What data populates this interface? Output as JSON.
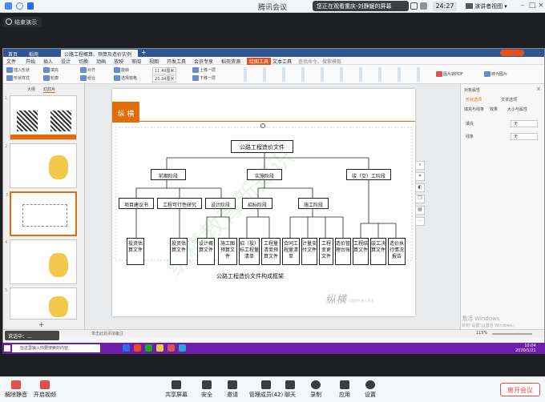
{
  "meeting": {
    "title": "腾讯会议",
    "share_banner": "您正在观看重庆-刘静媛的屏幕",
    "timer": "24:27",
    "view_mode": "演讲者视图",
    "stop_share": "结束演示",
    "mic_overlay": "说话中：..."
  },
  "wps": {
    "tabs": [
      "首页",
      "稻壳",
      "公路工程概算、预算及造价实例"
    ],
    "menu": [
      "文件",
      "开始",
      "插入",
      "设计",
      "切换",
      "动画",
      "放映",
      "审阅",
      "视图",
      "开发工具",
      "会员专享",
      "稻壳资源",
      "绘图工具",
      "文本工具",
      "查找命令、搜索模板"
    ],
    "menu_highlight": "绘图工具",
    "ribbon": [
      "插入形状",
      "形状样式",
      "填充",
      "轮廓",
      "对齐",
      "组合",
      "旋转",
      "选择窗格",
      "上移一层",
      "下移一层",
      "图片转PDF",
      "转为图片"
    ],
    "ribbon_values": [
      "11.49厘米",
      "23.34厘米"
    ],
    "thumb_tabs": [
      "大纲",
      "幻灯片"
    ],
    "slide_numbers": [
      "1",
      "2",
      "3",
      "4",
      "5"
    ],
    "selected_slide_index": 2,
    "status_left": "单击此处添加备注",
    "zoom": "115%",
    "prop_panel": {
      "title": "对象属性",
      "tabs": [
        "形状选项",
        "文本选项"
      ],
      "sub_tabs": [
        "填充与线条",
        "效果",
        "大小与属性"
      ],
      "rows": [
        {
          "label": "填充",
          "value": "无"
        },
        {
          "label": "线条",
          "value": "无"
        }
      ]
    },
    "activation": {
      "title": "激活 Windows",
      "subtitle": "转到\"设置\"以激活 Windows。"
    }
  },
  "slide": {
    "brand": "纵 横",
    "watermark": "纵横教育新知识",
    "logo": "纵横",
    "logo_sub": "建筑·工程造价·施工技术",
    "diagram": {
      "root": "公路工程造价文件",
      "phases": [
        "前期阶段",
        "实施阶段",
        "竣（交）工阶段"
      ],
      "front_items": [
        "项目建议书",
        "工程可行性研究",
        "设计阶段"
      ],
      "front_docs": [
        "投资估算文件",
        "投资估算文件",
        "设计概算文件",
        "施工图预算文件"
      ],
      "impl_items": [
        "招标阶段",
        "施工阶段"
      ],
      "bid_docs": [
        "招（投）标工程量清单",
        "工程量清单预算文件"
      ],
      "construct_docs": [
        "合同工程量清单",
        "计量支付文件",
        "工程变更文件",
        "造价管理台账"
      ],
      "final_docs": [
        "工程结算文件",
        "竣工决算文件",
        "造价执行情况报告"
      ],
      "caption": "公路工程造价文件构成框架"
    }
  },
  "taskbar": {
    "search_placeholder": "在这里输入你要搜索的内容",
    "time": "10:04",
    "date": "2020/1/21"
  },
  "toolbar": {
    "buttons": [
      "解除静音",
      "开启视频",
      "共享屏幕",
      "安全",
      "邀请",
      "管理成员(42)",
      "聊天",
      "录制",
      "应用",
      "设置"
    ],
    "leave": "离开会议"
  }
}
